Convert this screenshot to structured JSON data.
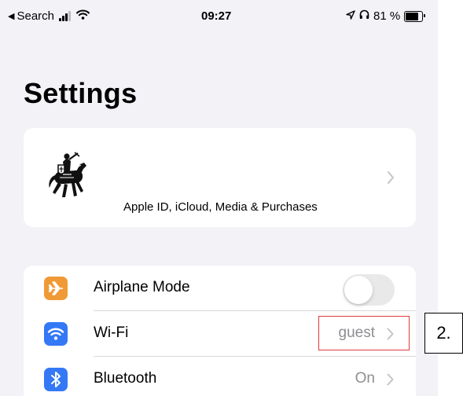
{
  "status_bar": {
    "back_label": "Search",
    "time": "09:27",
    "battery_percent": "81 %",
    "battery_level": 0.81
  },
  "page_title": "Settings",
  "profile": {
    "caption": "Apple ID, iCloud, Media & Purchases",
    "avatar_icon": "knight-emblem-icon"
  },
  "settings": {
    "rows": [
      {
        "label": "Airplane Mode",
        "icon": "airplane-icon",
        "icon_color": "#f09a37",
        "control": "toggle",
        "toggle_on": false
      },
      {
        "label": "Wi-Fi",
        "icon": "wifi-icon",
        "icon_color": "#3478f6",
        "value": "guest"
      },
      {
        "label": "Bluetooth",
        "icon": "bluetooth-icon",
        "icon_color": "#3478f6",
        "value": "On"
      }
    ]
  },
  "annotation": {
    "step_label": "2.",
    "highlight_color": "#e03a3a"
  }
}
